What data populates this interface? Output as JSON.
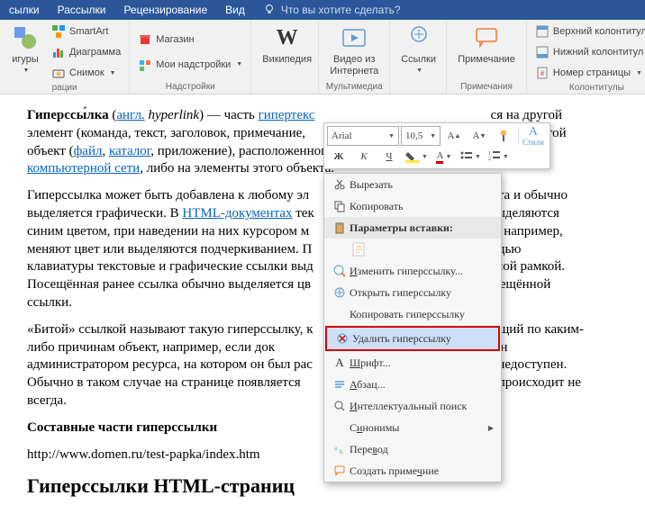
{
  "tabs": {
    "t1": "сылки",
    "t2": "Рассылки",
    "t3": "Рецензирование",
    "t4": "Вид",
    "tell": "Что вы хотите сделать?"
  },
  "ribbon": {
    "g1": {
      "figures": "игуры",
      "label": "рации",
      "smartart": "SmartArt",
      "diagram": "Диаграмма",
      "snapshot": "Снимок"
    },
    "g2": {
      "store": "Магазин",
      "addins": "Мои надстройки",
      "label": "Надстройки"
    },
    "g3": {
      "wiki": "Википедия"
    },
    "g4": {
      "video": "Видео из\nИнтернета",
      "label": "Мультимедиа"
    },
    "g5": {
      "links": "Ссылки"
    },
    "g6": {
      "comment": "Примечание",
      "label": "Примечания"
    },
    "g7": {
      "header": "Верхний колонтитул",
      "footer": "Нижний колонтитул",
      "pagenum": "Номер страницы",
      "label": "Колонтитулы"
    }
  },
  "mini": {
    "font": "Arial",
    "size": "10,5",
    "styles": "Стили",
    "bold": "Ж",
    "italic": "К",
    "under": "Ч"
  },
  "ctx": {
    "cut": "Вырезать",
    "copy": "Копировать",
    "paste_opts": "Параметры вставки:",
    "edit_link": "Изменить гиперссылку...",
    "open_link": "Открыть гиперссылку",
    "copy_link": "Копировать гиперссылку",
    "remove_link": "Удалить гиперссылку",
    "font": "Шрифт...",
    "para": "Абзац...",
    "search": "Интеллектуальный поиск",
    "syn": "Синонимы",
    "trans": "Перевод",
    "newcomment": "Создать примечание"
  },
  "doc": {
    "p1_a": "Гиперссы́лка",
    "p1_b": " (",
    "p1_link1": "англ.",
    "p1_c": " ",
    "p1_em": "hyperlink",
    "p1_d": ") — часть ",
    "p1_link2": "гипертекс",
    "p1_e": "ся на другой элемент (команда, текст, заголовок, примечание, ",
    "p1_f": "нте, на другой объект (",
    "p1_link3": "файл",
    "p1_g": ", ",
    "p1_link4": "каталог",
    "p1_h": ", приложение), расположенного ",
    "p1_link5": "компьютерной сети",
    "p1_i": ", либо на элементы этого объекта.",
    "p2_a": "Гиперссылка может быть добавлена к любому эл",
    "p2_b": "ента и обычно выделяется графически. В ",
    "p2_link1": "HTML-документах",
    "p2_c": " тек",
    "p2_d": "выделяются синим цветом, при наведении на них курсором м",
    "p2_e": "ся, например, меняют цвет или выделяются подчеркиванием. П",
    "p2_f": "ощью клавиатуры текстовые и графические ссылки выд",
    "p2_g": "рной рамкой. Посещённая ранее ссылка обычно выделяется цв",
    "p2_h": "осещённой ссылки.",
    "p3_a": "«Битой» ссылкой называют такую гиперссылку, к",
    "p3_b": "ющий по каким-либо причинам объект, например, если док",
    "p3_c": "еремещён администратором ресурса, на котором он был рас",
    "p3_d": "с недоступен. Обычно в таком случае на странице появляется",
    "p3_e": "это происходит не всегда.",
    "h1": "Составные части гиперссылки",
    "url": "http://www.domen.ru/test-papka/index.htm",
    "h2": "Гиперссылки HTML-страниц"
  }
}
